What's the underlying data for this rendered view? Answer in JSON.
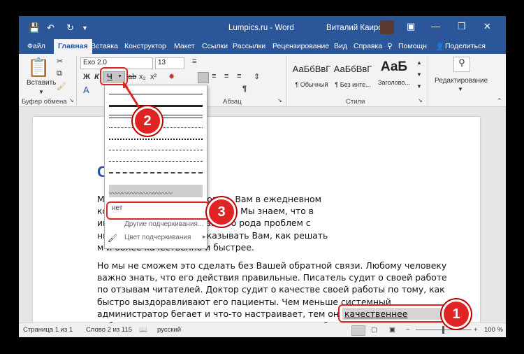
{
  "titlebar": {
    "doc_title": "Lumpics.ru - Word",
    "user": "Виталий Каиров"
  },
  "tabs": [
    "Файл",
    "Главная",
    "Вставка",
    "Конструктор",
    "Макет",
    "Ссылки",
    "Рассылки",
    "Рецензирование",
    "Вид",
    "Справка",
    "Помощн",
    "Поделиться"
  ],
  "ribbon": {
    "paste_label": "Вставить",
    "clipboard_group": "Буфер обмена",
    "font_name": "Exo 2.0",
    "font_size": "13",
    "bold": "Ж",
    "italic": "К",
    "underline": "Ч",
    "subscript": "x₂",
    "superscript": "x²",
    "paragraph_group": "Абзац",
    "styles_group": "Стили",
    "styles": [
      {
        "preview": "АаБбВвГ",
        "name": "¶ Обычный"
      },
      {
        "preview": "АаБбВвГ",
        "name": "¶ Без инте..."
      },
      {
        "preview": "АаБ",
        "name": "Заголово..."
      }
    ],
    "editing_label": "Редактирование"
  },
  "dropdown": {
    "none_label": "нет",
    "more_underlines": "Другие подчеркивания...",
    "underline_color": "Цвет подчеркивания"
  },
  "document": {
    "heading": "С",
    "para1_lines": [
      "М                              держимых идеей помогать Вам в ежедневном",
      "ко                            мобильными устройствами. Мы знаем, что в",
      "ин                            рмации о решении разного рода проблем с",
      "ни                            вает нас, чтобы рассказывать Вам, как решать",
      "м                               и более качественно и быстрее."
    ],
    "para2_lines": [
      "Но мы не сможем это сделать без Вашей обратной связи. Любому человеку",
      "важно знать, что его действия правильные. Писатель судит о своей работе",
      "по отзывам читателей. Доктор судит о качестве своей работы по тому, как",
      "быстро выздоравливают его пациенты. Чем меньше системный",
      "администратор бегает и что-то настраивает, тем он качественнее делает",
      "работу. Так и мы не можем улучшаться, если не будем получать обратной"
    ],
    "selected_text": "качественнее делает"
  },
  "callouts": [
    "1",
    "2",
    "3"
  ],
  "status": {
    "page": "Страница 1 из 1",
    "words": "Слово 2 из 115",
    "language": "русский",
    "zoom": "100 %"
  },
  "colors": {
    "accent": "#2b579a",
    "callout": "#e02424"
  }
}
